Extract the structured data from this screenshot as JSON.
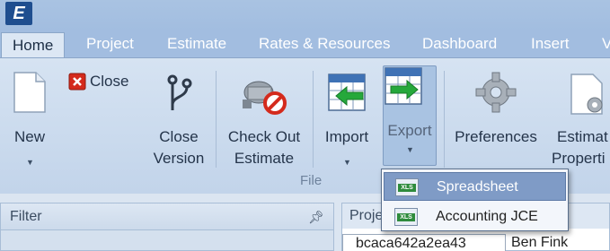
{
  "titlebar": {
    "logo_letter": "E"
  },
  "tabs": [
    {
      "label": "Home"
    },
    {
      "label": "Project"
    },
    {
      "label": "Estimate"
    },
    {
      "label": "Rates & Resources"
    },
    {
      "label": "Dashboard"
    },
    {
      "label": "Insert"
    },
    {
      "label": "V"
    }
  ],
  "ribbon": {
    "new_label": "New",
    "close_label": "Close",
    "close_version_line1": "Close",
    "close_version_line2": "Version",
    "checkout_line1": "Check Out",
    "checkout_line2": "Estimate",
    "import_label": "Import",
    "export_label": "Export",
    "preferences_label": "Preferences",
    "estimate_props_line1": "Estimat",
    "estimate_props_line2": "Properti",
    "group_label": "File"
  },
  "export_menu": [
    {
      "label": "Spreadsheet",
      "icon": "xls-icon"
    },
    {
      "label": "Accounting JCE",
      "icon": "xls-icon"
    }
  ],
  "filter_panel": {
    "title": "Filter",
    "pin_icon": "pin-icon"
  },
  "project_panel": {
    "title": "Proje",
    "hash_value": "bcaca642a2ea43",
    "owner": "Ben Fink"
  }
}
